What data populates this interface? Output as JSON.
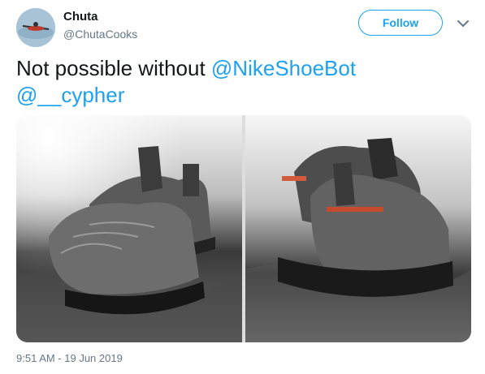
{
  "tweet": {
    "author_name": "Chuta",
    "author_handle": "@ChutaCooks",
    "follow_label": "Follow",
    "text_prefix": "Not possible without ",
    "mentions": [
      "@NikeShoeBot",
      "@__cypher"
    ],
    "timestamp": "9:51 AM - 19 Jun 2019"
  },
  "icons": {
    "more": "chevron-down-icon",
    "avatar": "kayak-avatar"
  },
  "colors": {
    "accent": "#1da1f2",
    "text": "#14171a",
    "muted": "#657786"
  }
}
